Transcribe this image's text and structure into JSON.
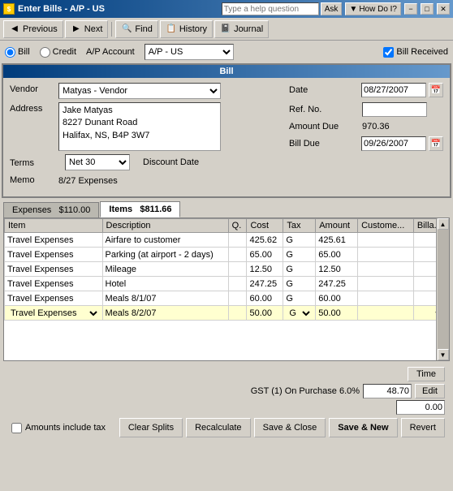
{
  "titleBar": {
    "title": "Enter Bills - A/P - US",
    "helpPlaceholder": "Type a help question",
    "helpBtn": "Ask",
    "howDoBtn": "How Do I?",
    "minBtn": "−",
    "maxBtn": "□",
    "closeBtn": "✕"
  },
  "toolbar": {
    "previousBtn": "Previous",
    "nextBtn": "Next",
    "findBtn": "Find",
    "historyBtn": "History",
    "journalBtn": "Journal"
  },
  "radioRow": {
    "billLabel": "Bill",
    "creditLabel": "Credit",
    "apAccountLabel": "A/P Account",
    "apAccountValue": "A/P - US",
    "billReceivedLabel": "Bill Received"
  },
  "billPanel": {
    "title": "Bill",
    "vendorLabel": "Vendor",
    "vendorValue": "Matyas - Vendor",
    "addressLabel": "Address",
    "addressLines": [
      "Jake Matyas",
      "8227 Dunant Road",
      "Halifax, NS, B4P 3W7"
    ],
    "termsLabel": "Terms",
    "termsValue": "Net 30",
    "discountDateLabel": "Discount Date",
    "memoLabel": "Memo",
    "memoValue": "8/27 Expenses",
    "dateLabel": "Date",
    "dateValue": "08/27/2007",
    "refNoLabel": "Ref. No.",
    "amountDueLabel": "Amount Due",
    "amountDueValue": "970.36",
    "billDueLabel": "Bill Due",
    "billDueValue": "09/26/2007"
  },
  "tabs": [
    {
      "label": "Expenses",
      "amount": "$110.00",
      "active": false
    },
    {
      "label": "Items",
      "amount": "$811.66",
      "active": true
    }
  ],
  "table": {
    "headers": [
      "Item",
      "Description",
      "Q.",
      "Cost",
      "Tax",
      "Amount",
      "Custome...",
      "Billa..."
    ],
    "rows": [
      {
        "item": "Travel Expenses",
        "description": "Airfare to customer",
        "qty": "",
        "cost": "425.62",
        "tax": "G",
        "amount": "425.61",
        "customer": "",
        "billable": ""
      },
      {
        "item": "Travel Expenses",
        "description": "Parking (at airport - 2 days)",
        "qty": "",
        "cost": "65.00",
        "tax": "G",
        "amount": "65.00",
        "customer": "",
        "billable": ""
      },
      {
        "item": "Travel Expenses",
        "description": "Mileage",
        "qty": "",
        "cost": "12.50",
        "tax": "G",
        "amount": "12.50",
        "customer": "",
        "billable": ""
      },
      {
        "item": "Travel Expenses",
        "description": "Hotel",
        "qty": "",
        "cost": "247.25",
        "tax": "G",
        "amount": "247.25",
        "customer": "",
        "billable": ""
      },
      {
        "item": "Travel Expenses",
        "description": "Meals 8/1/07",
        "qty": "",
        "cost": "60.00",
        "tax": "G",
        "amount": "60.00",
        "customer": "",
        "billable": ""
      },
      {
        "item": "Travel Expenses",
        "description": "Meals 8/2/07",
        "qty": "",
        "cost": "50.00",
        "tax": "G",
        "amount": "50.00",
        "customer": "",
        "billable": "",
        "isEditing": true
      }
    ]
  },
  "bottom": {
    "timeBtn": "Time",
    "gstLabel": "GST (1) On Purchase 6.0%",
    "gstValue": "48.70",
    "editBtn": "Edit",
    "zeroValue": "0.00",
    "amountsTaxLabel": "Amounts include tax",
    "clearSplitsBtn": "Clear Splits",
    "recalculateBtn": "Recalculate",
    "saveCloseBtn": "Save & Close",
    "saveNewBtn": "Save & New",
    "revertBtn": "Revert"
  },
  "colors": {
    "titleBarStart": "#003c7c",
    "titleBarEnd": "#6699cc",
    "tabActive": "#ffffff",
    "tabInactive": "#bab8b0",
    "editingRow": "#ffffd0"
  }
}
